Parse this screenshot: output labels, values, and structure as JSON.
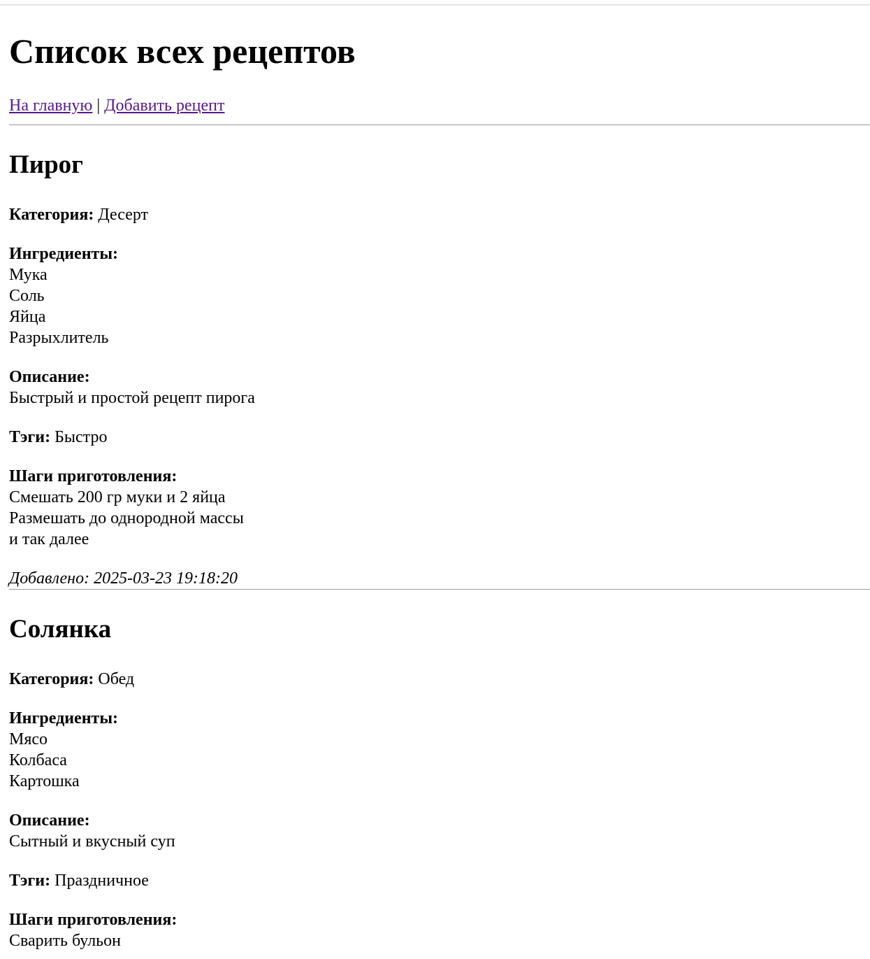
{
  "page": {
    "title": "Список всех рецептов",
    "nav": {
      "home_label": "На главную",
      "separator": "|",
      "add_label": "Добавить рецепт",
      "link_color": "#551a8b"
    }
  },
  "labels": {
    "category": "Категория:",
    "ingredients": "Ингредиенты:",
    "description": "Описание:",
    "tags": "Тэги:",
    "steps": "Шаги приготовления:",
    "added": "Добавлено:"
  },
  "recipes": [
    {
      "name": "Пирог",
      "category": "Десерт",
      "ingredients": [
        "Мука",
        "Соль",
        "Яйца",
        "Разрыхлитель"
      ],
      "description": "Быстрый и простой рецепт пирога",
      "tags": "Быстро",
      "steps": [
        "Смешать 200 гр муки и 2 яйца",
        "Размешать до однородной массы",
        "и так далее"
      ],
      "added": "2025-03-23 19:18:20"
    },
    {
      "name": "Солянка",
      "category": "Обед",
      "ingredients": [
        "Мясо",
        "Колбаса",
        "Картошка"
      ],
      "description": "Сытный и вкусный суп",
      "tags": "Праздничное",
      "steps": [
        "Сварить бульон"
      ]
    }
  ]
}
